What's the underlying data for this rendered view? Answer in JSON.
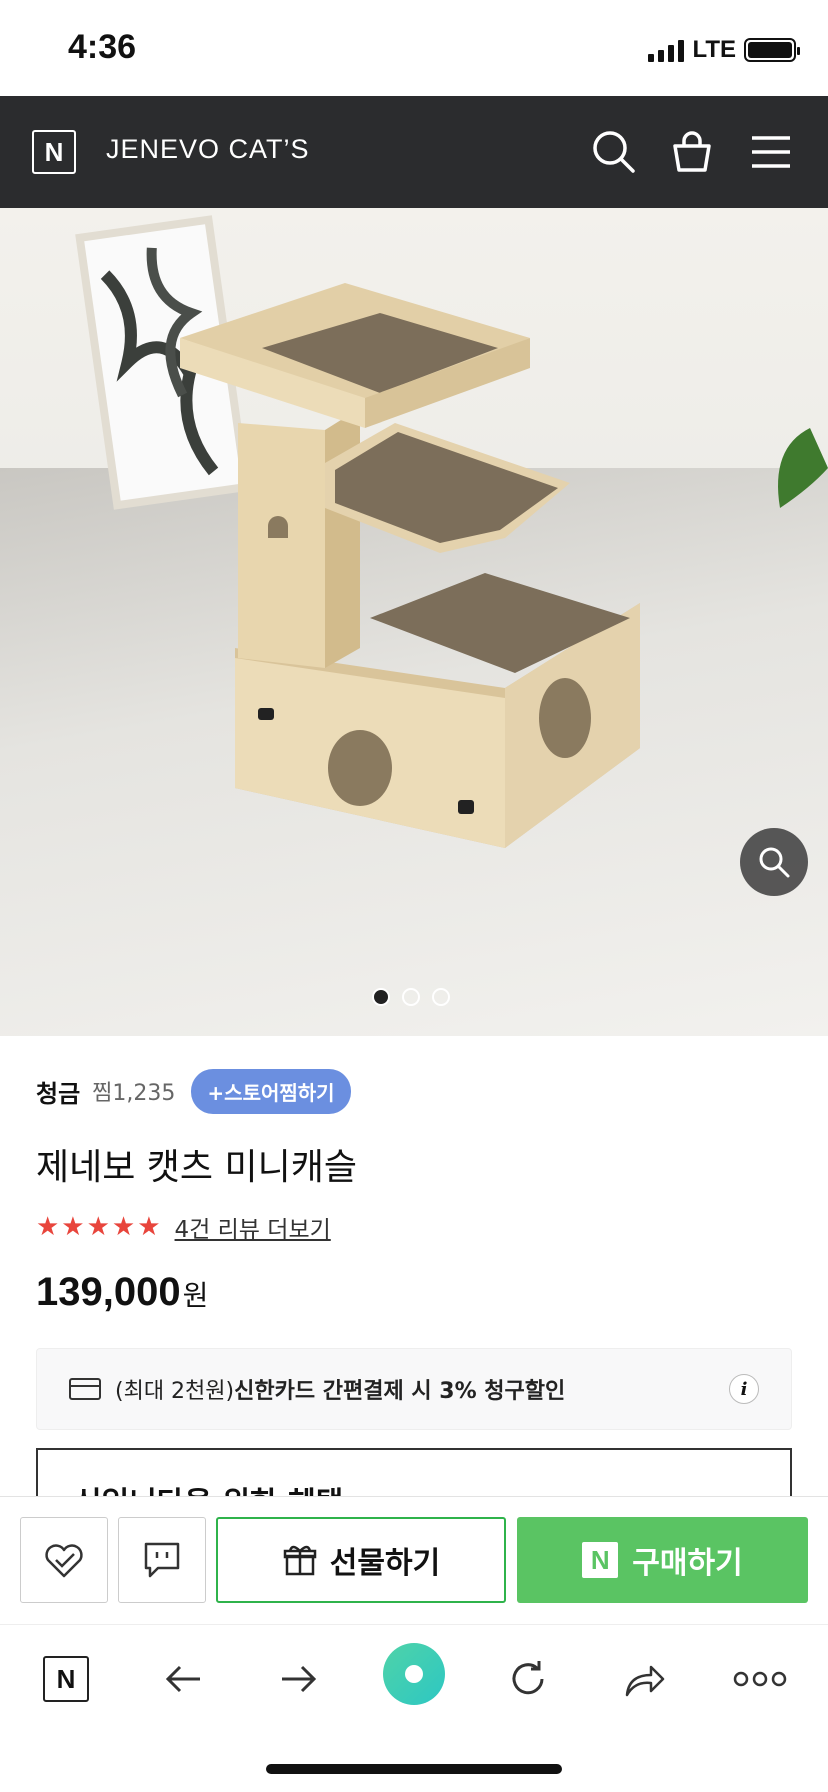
{
  "status": {
    "time": "4:36",
    "network": "LTE"
  },
  "header": {
    "logo_letter": "N",
    "store_name": "JENEVO CAT’S"
  },
  "hero": {
    "image_alt": "",
    "page_count": 3,
    "active_page": 1
  },
  "product": {
    "seller": "청금",
    "wish_count": "찜1,235",
    "store_wish_label": "+스토어찜하기",
    "title": "제네보 캣츠 미니캐슬",
    "rating_stars": 5,
    "stars_text": "★★★★★",
    "review_link": "4건 리뷰 더보기",
    "price": "139,000",
    "currency": "원"
  },
  "benefit": {
    "prefix": "(최대 2천원)",
    "highlight": "신한카드 간편결제 시 3% 청구할인",
    "info_label": "i"
  },
  "partial_section": {
    "text": "신입니다을 위한 혜택"
  },
  "buy_bar": {
    "gift_label": "선물하기",
    "purchase_label": "구매하기",
    "purchase_logo": "N"
  },
  "browser": {
    "home_letter": "N"
  },
  "colors": {
    "header_bg": "#2b2c2e",
    "accent_green": "#5ac463",
    "store_wish_blue": "#6b8fe0",
    "star_red": "#e8453c"
  }
}
